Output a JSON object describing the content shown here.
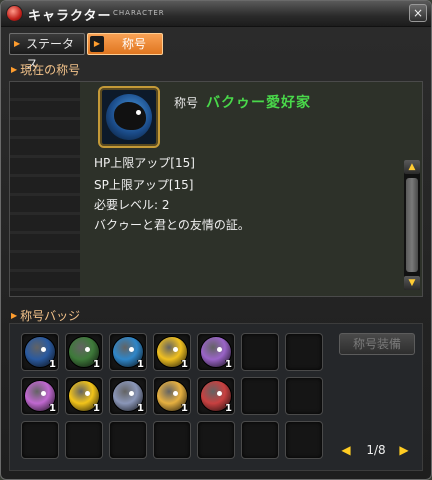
{
  "window": {
    "title": "キャラクター",
    "subtitle": "CHARACTER",
    "close_symbol": "×"
  },
  "tabs": [
    {
      "label": "ステータス",
      "active": false
    },
    {
      "label": "称号",
      "active": true
    }
  ],
  "current": {
    "header": "現在の称号",
    "title_label": "称号",
    "title_name": "バクゥー愛好家",
    "portrait_icon": "bakuu-badge-icon",
    "description": [
      "HP上限アップ[15]",
      "SP上限アップ[15]",
      "必要レベル: 2",
      "バクゥーと君との友情の証。"
    ]
  },
  "badges": {
    "header": "称号バッジ",
    "equip_label": "称号装備",
    "page": "1/8",
    "items": [
      {
        "icon": "black-bakuu-icon",
        "count": "1",
        "color": "#2a5aa0"
      },
      {
        "icon": "green-melon-icon",
        "count": "1",
        "color": "#3e7a3a"
      },
      {
        "icon": "blue-whale-icon",
        "count": "1",
        "color": "#2f86c8"
      },
      {
        "icon": "yellow-chick-icon",
        "count": "1",
        "color": "#f0c020"
      },
      {
        "icon": "purple-fish-icon",
        "count": "1",
        "color": "#9a64c8"
      },
      {
        "icon": "pink-ghost-icon",
        "count": "1",
        "color": "#c068d0"
      },
      {
        "icon": "yellow-monster-icon",
        "count": "1",
        "color": "#f2c41a"
      },
      {
        "icon": "grey-shark-icon",
        "count": "1",
        "color": "#8a96b8"
      },
      {
        "icon": "pink-chick-icon",
        "count": "1",
        "color": "#e6b040"
      },
      {
        "icon": "red-fish-icon",
        "count": "1",
        "color": "#c84040"
      }
    ]
  },
  "icons": {
    "prev": "◀",
    "next": "▶",
    "up": "▲",
    "down": "▼",
    "tab_marker": "▶",
    "section_marker": "▶"
  }
}
